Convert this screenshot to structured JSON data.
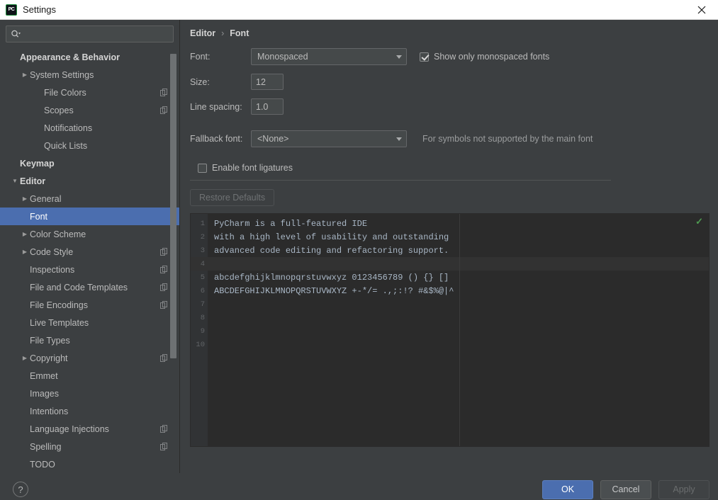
{
  "window": {
    "title": "Settings",
    "app_icon": "pycharm-icon",
    "close_icon": "close-icon"
  },
  "search": {
    "placeholder": "",
    "value": "",
    "icon": "search-icon"
  },
  "sidebar": {
    "items": [
      {
        "label": "Appearance & Behavior",
        "indent": 0,
        "group": true,
        "arrow": "none",
        "badge": false
      },
      {
        "label": "System Settings",
        "indent": 1,
        "group": false,
        "arrow": "collapsed",
        "badge": false
      },
      {
        "label": "File Colors",
        "indent": 2,
        "group": false,
        "arrow": "none",
        "badge": true
      },
      {
        "label": "Scopes",
        "indent": 2,
        "group": false,
        "arrow": "none",
        "badge": true
      },
      {
        "label": "Notifications",
        "indent": 2,
        "group": false,
        "arrow": "none",
        "badge": false
      },
      {
        "label": "Quick Lists",
        "indent": 2,
        "group": false,
        "arrow": "none",
        "badge": false
      },
      {
        "label": "Keymap",
        "indent": 0,
        "group": true,
        "arrow": "none",
        "badge": false
      },
      {
        "label": "Editor",
        "indent": 0,
        "group": true,
        "arrow": "expanded",
        "badge": false
      },
      {
        "label": "General",
        "indent": 1,
        "group": false,
        "arrow": "collapsed",
        "badge": false
      },
      {
        "label": "Font",
        "indent": 1,
        "group": false,
        "arrow": "none",
        "badge": false,
        "selected": true
      },
      {
        "label": "Color Scheme",
        "indent": 1,
        "group": false,
        "arrow": "collapsed",
        "badge": false
      },
      {
        "label": "Code Style",
        "indent": 1,
        "group": false,
        "arrow": "collapsed",
        "badge": true
      },
      {
        "label": "Inspections",
        "indent": 1,
        "group": false,
        "arrow": "none",
        "badge": true
      },
      {
        "label": "File and Code Templates",
        "indent": 1,
        "group": false,
        "arrow": "none",
        "badge": true
      },
      {
        "label": "File Encodings",
        "indent": 1,
        "group": false,
        "arrow": "none",
        "badge": true
      },
      {
        "label": "Live Templates",
        "indent": 1,
        "group": false,
        "arrow": "none",
        "badge": false
      },
      {
        "label": "File Types",
        "indent": 1,
        "group": false,
        "arrow": "none",
        "badge": false
      },
      {
        "label": "Copyright",
        "indent": 1,
        "group": false,
        "arrow": "collapsed",
        "badge": true
      },
      {
        "label": "Emmet",
        "indent": 1,
        "group": false,
        "arrow": "none",
        "badge": false
      },
      {
        "label": "Images",
        "indent": 1,
        "group": false,
        "arrow": "none",
        "badge": false
      },
      {
        "label": "Intentions",
        "indent": 1,
        "group": false,
        "arrow": "none",
        "badge": false
      },
      {
        "label": "Language Injections",
        "indent": 1,
        "group": false,
        "arrow": "none",
        "badge": true
      },
      {
        "label": "Spelling",
        "indent": 1,
        "group": false,
        "arrow": "none",
        "badge": true
      },
      {
        "label": "TODO",
        "indent": 1,
        "group": false,
        "arrow": "none",
        "badge": false
      }
    ]
  },
  "breadcrumb": {
    "root": "Editor",
    "separator": "›",
    "leaf": "Font"
  },
  "form": {
    "font_label": "Font:",
    "font_value": "Monospaced",
    "monospaced_only_label": "Show only monospaced fonts",
    "monospaced_only_checked": true,
    "size_label": "Size:",
    "size_value": "12",
    "line_spacing_label": "Line spacing:",
    "line_spacing_value": "1.0",
    "fallback_label": "Fallback font:",
    "fallback_value": "<None>",
    "fallback_hint": "For symbols not supported by the main font",
    "ligatures_label": "Enable font ligatures",
    "ligatures_checked": false,
    "restore_defaults_label": "Restore Defaults",
    "restore_defaults_enabled": false
  },
  "preview": {
    "inspection_icon": "checkmark-icon",
    "current_line": 4,
    "lines": [
      {
        "num": "1",
        "text": "PyCharm is a full-featured IDE"
      },
      {
        "num": "2",
        "text": "with a high level of usability and outstanding"
      },
      {
        "num": "3",
        "text": "advanced code editing and refactoring support."
      },
      {
        "num": "4",
        "text": ""
      },
      {
        "num": "5",
        "text": "abcdefghijklmnopqrstuvwxyz 0123456789 () {} []"
      },
      {
        "num": "6",
        "text": "ABCDEFGHIJKLMNOPQRSTUVWXYZ +-*/= .,;:!? #&$%@|^"
      },
      {
        "num": "7",
        "text": ""
      },
      {
        "num": "8",
        "text": ""
      },
      {
        "num": "9",
        "text": ""
      },
      {
        "num": "10",
        "text": ""
      }
    ]
  },
  "footer": {
    "help_label": "?",
    "ok_label": "OK",
    "cancel_label": "Cancel",
    "apply_label": "Apply",
    "apply_enabled": false
  },
  "colors": {
    "accent": "#4b6eaf",
    "window_bg": "#3c3f41",
    "editor_bg": "#2b2b2b",
    "text": "#bbbbbb",
    "inspection_ok": "#4e9a51"
  }
}
